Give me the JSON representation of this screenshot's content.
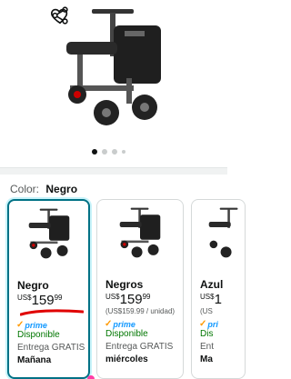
{
  "gallery": {
    "dots": 4,
    "active_index": 0,
    "icons": [
      "heart-icon",
      "share-icon"
    ]
  },
  "color_selector": {
    "label": "Color:",
    "selected": "Negro"
  },
  "variants": [
    {
      "name": "Negro",
      "currency": "US$",
      "price_whole": "159",
      "price_cents": "99",
      "unit_price": "",
      "prime": "prime",
      "availability": "Disponible",
      "shipping": "Entrega GRATIS",
      "delivery_day": "Mañana",
      "selected": true
    },
    {
      "name": "Negros",
      "currency": "US$",
      "price_whole": "159",
      "price_cents": "99",
      "unit_price": "(US$159.99 / unidad)",
      "prime": "prime",
      "availability": "Disponible",
      "shipping": "Entrega GRATIS",
      "delivery_day": "miércoles",
      "selected": false
    },
    {
      "name": "Azul",
      "currency": "US$",
      "price_whole": "1",
      "price_cents": "",
      "unit_price": "(US",
      "prime": "pri",
      "availability": "Dis",
      "shipping": "Ent",
      "delivery_day": "Ma",
      "selected": false
    }
  ],
  "colors": {
    "accent": "#007185",
    "prime_blue": "#1399ff",
    "available_green": "#007600",
    "annotation_red": "#e00000"
  }
}
